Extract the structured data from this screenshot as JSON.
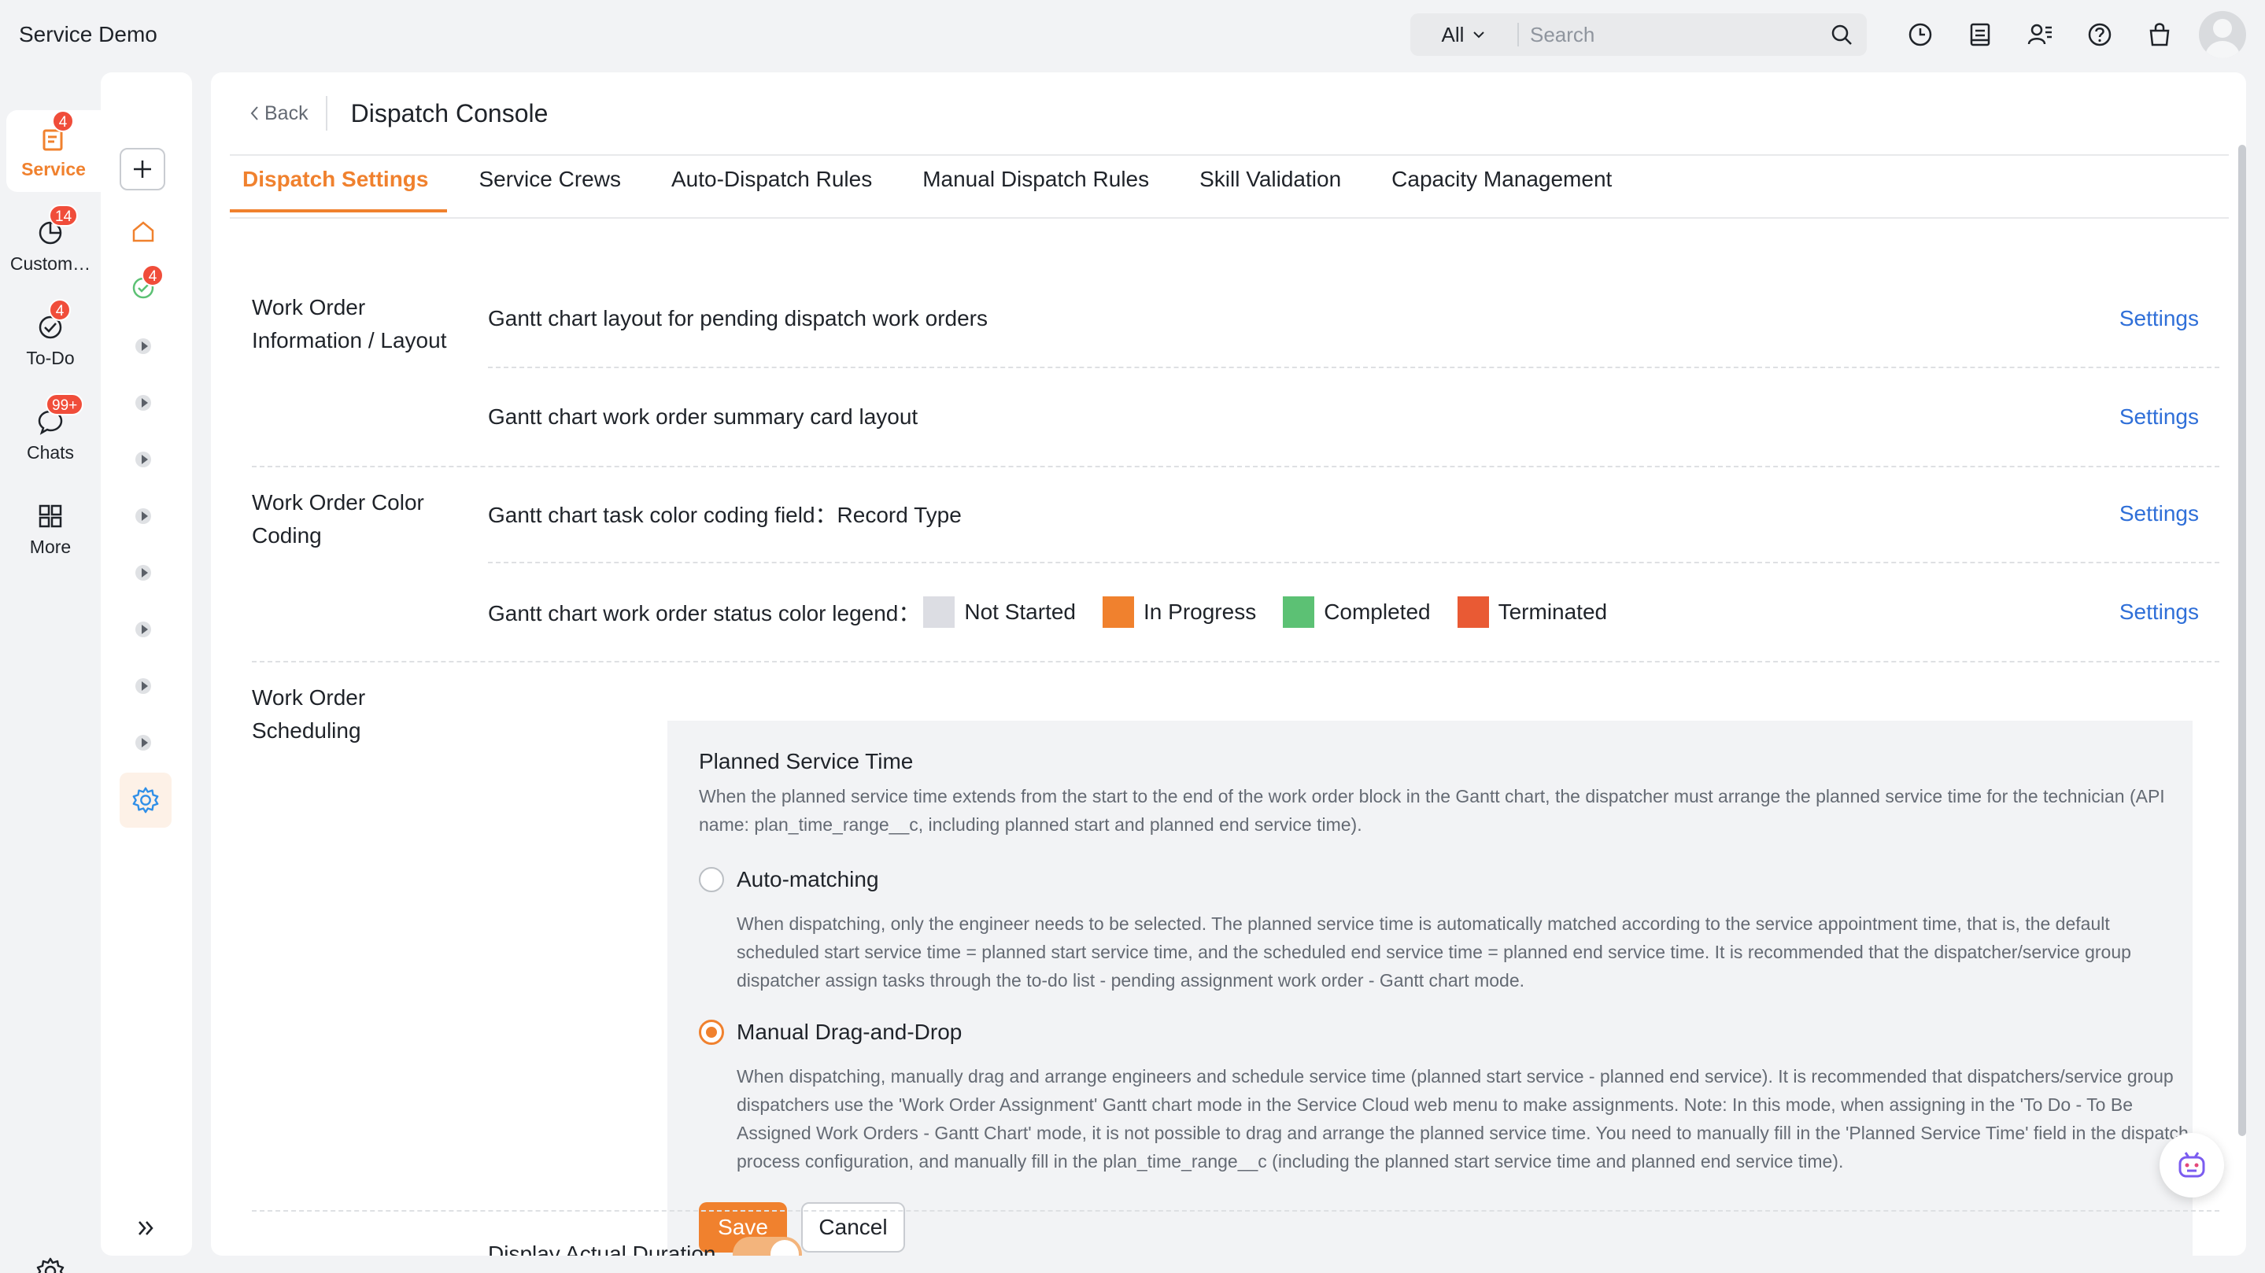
{
  "app": {
    "title": "Service Demo"
  },
  "search": {
    "scope": "All",
    "placeholder": "Search"
  },
  "topbar_icons": [
    "clock-icon",
    "document-icon",
    "user-list-icon",
    "help-icon",
    "shopping-bag-icon",
    "avatar"
  ],
  "leftnav": {
    "items": [
      {
        "label": "Service",
        "icon": "service-icon",
        "badge": "4",
        "active": true
      },
      {
        "label": "Custom…",
        "icon": "customer-icon",
        "badge": "14",
        "active": false
      },
      {
        "label": "To-Do",
        "icon": "todo-icon",
        "badge": "4",
        "active": false
      },
      {
        "label": "Chats",
        "icon": "chat-icon",
        "badge": "99+",
        "active": false
      },
      {
        "label": "More",
        "icon": "grid-icon",
        "badge": "",
        "active": false
      }
    ]
  },
  "subside": {
    "check_badge": "4"
  },
  "header": {
    "back_label": "Back",
    "title": "Dispatch Console"
  },
  "tabs": [
    {
      "label": "Dispatch Settings",
      "active": true
    },
    {
      "label": "Service Crews",
      "active": false
    },
    {
      "label": "Auto-Dispatch Rules",
      "active": false
    },
    {
      "label": "Manual Dispatch Rules",
      "active": false
    },
    {
      "label": "Skill Validation",
      "active": false
    },
    {
      "label": "Capacity Management",
      "active": false
    }
  ],
  "sections": {
    "info_layout": {
      "label": "Work Order Information / Layout",
      "rows": [
        {
          "text": "Gantt chart layout for pending dispatch work orders",
          "link": "Settings"
        },
        {
          "text": "Gantt chart work order summary card layout",
          "link": "Settings"
        }
      ]
    },
    "color_coding": {
      "label": "Work Order Color Coding",
      "field_row": {
        "text": "Gantt chart task color coding field：Record Type",
        "link": "Settings"
      },
      "legend_row": {
        "text": "Gantt chart work order status color legend：",
        "link": "Settings",
        "legend": [
          {
            "label": "Not Started",
            "color": "#dcdde3"
          },
          {
            "label": "In Progress",
            "color": "#f0812e"
          },
          {
            "label": "Completed",
            "color": "#5cc174"
          },
          {
            "label": "Terminated",
            "color": "#e95a34"
          }
        ]
      }
    },
    "scheduling": {
      "label": "Work Order Scheduling",
      "title": "Planned Service Time",
      "description": "When the planned service time extends from the start to the end of the work order block in the Gantt chart, the dispatcher must arrange the planned service time for the technician (API name: plan_time_range__c, including planned start and planned end service time).",
      "options": [
        {
          "label": "Auto-matching",
          "checked": false,
          "description": "When dispatching, only the engineer needs to be selected. The planned service time is automatically matched according to the service appointment time, that is, the default scheduled start service time = planned start service time, and the scheduled end service time = planned end service time. It is recommended that the dispatcher/service group dispatcher assign tasks through the to-do list - pending assignment work order - Gantt chart mode."
        },
        {
          "label": "Manual Drag-and-Drop",
          "checked": true,
          "description": "When dispatching, manually drag and arrange engineers and schedule service time (planned start service - planned end service). It is recommended that dispatchers/service group dispatchers use the 'Work Order Assignment' Gantt chart mode in the Service Cloud web menu to make assignments. Note: In this mode, when assigning in the 'To Do - To Be Assigned Work Orders - Gantt Chart' mode, it is not possible to drag and arrange the planned service time. You need to manually fill in the 'Planned Service Time' field in the dispatch process configuration, and manually fill in the plan_time_range__c (including the planned start service time and planned end service time)."
        }
      ],
      "save_label": "Save",
      "cancel_label": "Cancel"
    },
    "peek": {
      "label": "Display Actual Duration",
      "toggle_on": true
    }
  },
  "colors": {
    "accent": "#f0812e",
    "link": "#2f6fd8",
    "badge": "#f04d3a"
  }
}
